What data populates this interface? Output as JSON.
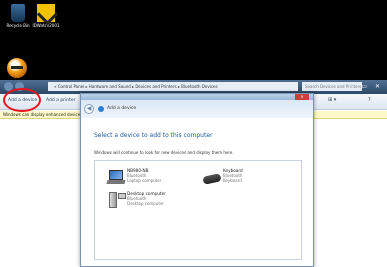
{
  "desktop_icons": [
    {
      "label": "Recycle Bin"
    },
    {
      "label": "IDWatch2001"
    }
  ],
  "explorer": {
    "address": "« Control Panel ▸ Hardware and Sound ▸ Devices and Printers ▸ Bluetooth Devices",
    "search_placeholder": "Search Devices and Printers",
    "window_controls": "– ▭ ✕",
    "toolbar": {
      "add_device": "Add a device",
      "add_printer": "Add a printer",
      "view_glyph": "⊞ ▾",
      "help_glyph": "?"
    },
    "infobar": "Windows can display enhanced device icons and information from the Internet. Click to change..."
  },
  "dialog": {
    "app_title": "Add a device",
    "close": "✕",
    "back": "◀",
    "heading": "Select a device to add to this computer",
    "subtitle": "Windows will continue to look for new devices and display them here.",
    "devices": [
      {
        "name": "NB980-NB",
        "type": "Bluetooth",
        "category": "Laptop computer"
      },
      {
        "name": "Keyboard",
        "type": "Bluetooth",
        "category": "Keyboard"
      },
      {
        "name": "Desktop computer",
        "type": "Bluetooth",
        "category": "Desktop computer"
      }
    ]
  }
}
